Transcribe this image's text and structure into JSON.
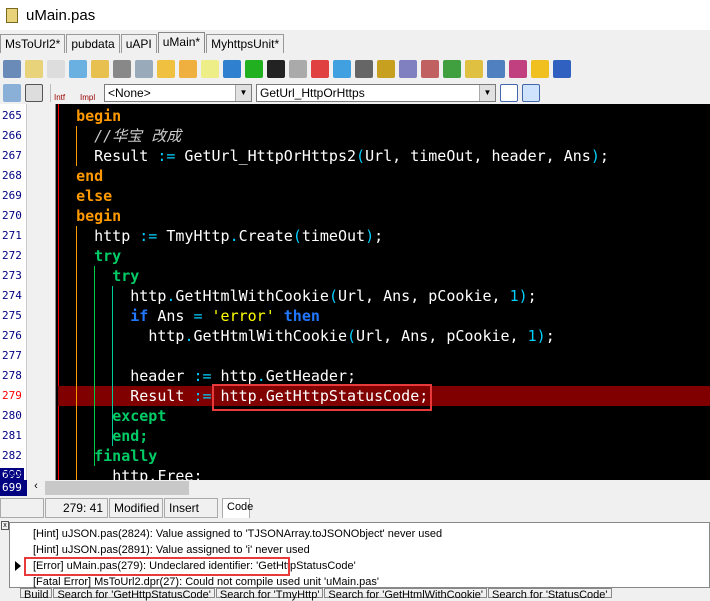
{
  "window": {
    "title": "uMain.pas"
  },
  "tabs": [
    "MsToUrl2*",
    "pubdata",
    "uAPI",
    "uMain*",
    "MyhttpsUnit*"
  ],
  "toolbar": {
    "scope_combo": "<None>",
    "method_combo": "GetUrl_HttpOrHttps",
    "intf_label": "Intf",
    "impl_label": "Impl"
  },
  "editor": {
    "line_numbers": [
      "265",
      "266",
      "267",
      "268",
      "269",
      "270",
      "271",
      "272",
      "273",
      "274",
      "275",
      "276",
      "277",
      "278",
      "279",
      "280",
      "281",
      "282",
      "283"
    ],
    "bottom_line": "699",
    "lines": [
      {
        "i": 2,
        "p": [
          [
            "kw",
            "begin"
          ]
        ]
      },
      {
        "i": 4,
        "p": [
          [
            "cm",
            "//华宝 改成"
          ]
        ]
      },
      {
        "i": 4,
        "p": [
          [
            "",
            "Result "
          ],
          [
            "op",
            ":="
          ],
          [
            "",
            " GetUrl_HttpOrHttps2"
          ],
          [
            "op",
            "("
          ],
          [
            "",
            "Url, timeOut, header, Ans"
          ],
          [
            "op",
            ")"
          ],
          [
            "",
            ";"
          ]
        ]
      },
      {
        "i": 2,
        "p": [
          [
            "kw",
            "end"
          ]
        ]
      },
      {
        "i": 2,
        "p": [
          [
            "kw",
            "else"
          ]
        ]
      },
      {
        "i": 2,
        "p": [
          [
            "kw",
            "begin"
          ]
        ]
      },
      {
        "i": 4,
        "p": [
          [
            "",
            "http "
          ],
          [
            "op",
            ":="
          ],
          [
            "",
            " TmyHttp"
          ],
          [
            "op",
            "."
          ],
          [
            "",
            "Create"
          ],
          [
            "op",
            "("
          ],
          [
            "",
            "timeOut"
          ],
          [
            "op",
            ")"
          ],
          [
            "",
            ";"
          ]
        ]
      },
      {
        "i": 4,
        "p": [
          [
            "kg",
            "try"
          ]
        ]
      },
      {
        "i": 6,
        "p": [
          [
            "kg",
            "try"
          ]
        ]
      },
      {
        "i": 8,
        "p": [
          [
            "",
            "http"
          ],
          [
            "op",
            "."
          ],
          [
            "",
            "GetHtmlWithCookie"
          ],
          [
            "op",
            "("
          ],
          [
            "",
            "Url, Ans, pCookie, "
          ],
          [
            "op",
            "1"
          ],
          [
            "op",
            ")"
          ],
          [
            "",
            ";"
          ]
        ]
      },
      {
        "i": 8,
        "p": [
          [
            "kb",
            "if"
          ],
          [
            "",
            " Ans "
          ],
          [
            "op",
            "="
          ],
          [
            "",
            " "
          ],
          [
            "str",
            "'error'"
          ],
          [
            "",
            " "
          ],
          [
            "kb",
            "then"
          ]
        ]
      },
      {
        "i": 10,
        "p": [
          [
            "",
            "http"
          ],
          [
            "op",
            "."
          ],
          [
            "",
            "GetHtmlWithCookie"
          ],
          [
            "op",
            "("
          ],
          [
            "",
            "Url, Ans, pCookie, "
          ],
          [
            "op",
            "1"
          ],
          [
            "op",
            ")"
          ],
          [
            "",
            ";"
          ]
        ]
      },
      {
        "i": 0,
        "p": []
      },
      {
        "i": 8,
        "p": [
          [
            "",
            "header "
          ],
          [
            "op",
            ":="
          ],
          [
            "",
            " http"
          ],
          [
            "op",
            "."
          ],
          [
            "",
            "GetHeader;"
          ]
        ]
      },
      {
        "i": 8,
        "p": [
          [
            "",
            "Result "
          ],
          [
            "op",
            ":="
          ],
          [
            "",
            " http.GetHttpStatusCode;"
          ]
        ]
      },
      {
        "i": 6,
        "p": [
          [
            "kg",
            "except"
          ]
        ]
      },
      {
        "i": 6,
        "p": [
          [
            "kg",
            "end;"
          ]
        ]
      },
      {
        "i": 4,
        "p": [
          [
            "kg",
            "finally"
          ]
        ]
      },
      {
        "i": 6,
        "p": [
          [
            "",
            "http.Free;"
          ]
        ]
      }
    ]
  },
  "statusbar": {
    "position": "279:  41",
    "modified": "Modified",
    "mode": "Insert",
    "view_tab": "Code"
  },
  "messages": [
    "[Hint] uJSON.pas(2824): Value assigned to 'TJSONArray.toJSONObject' never used",
    "[Hint] uJSON.pas(2891): Value assigned to 'i' never used",
    "[Error] uMain.pas(279): Undeclared identifier: 'GetHttpStatusCode'",
    "[Fatal Error] MsToUrl2.dpr(27): Could not compile used unit 'uMain.pas'"
  ],
  "message_tabs": [
    "Build",
    "Search for 'GetHttpStatusCode'",
    "Search for 'TmyHttp'",
    "Search for 'GetHtmlWithCookie'",
    "Search for 'StatusCode'"
  ]
}
